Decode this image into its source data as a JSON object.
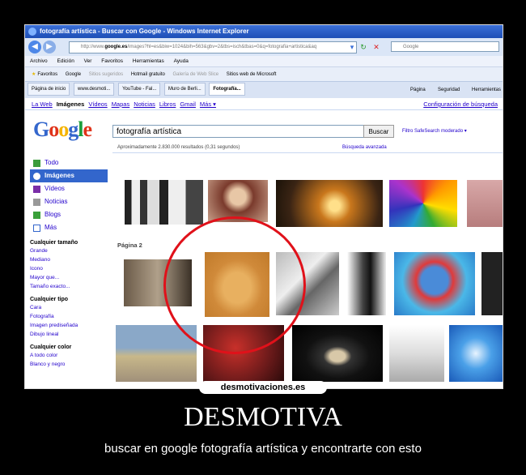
{
  "window": {
    "title": "fotografía artística - Buscar con Google - Windows Internet Explorer"
  },
  "address": {
    "prefix": "http://www.",
    "domain": "google.es",
    "rest": "/images?hl=es&biw=1024&bih=563&gbv=2&tbs=isch&tbas=0&q=fotografia+artistica&aq"
  },
  "search_placeholder": "Google",
  "menu": [
    "Archivo",
    "Edición",
    "Ver",
    "Favoritos",
    "Herramientas",
    "Ayuda"
  ],
  "favorites": {
    "label": "Favoritos",
    "items": [
      "Google",
      "Sitios sugeridos",
      "Hotmail gratuito",
      "Galería de Web Slice",
      "Sitios web de Microsoft"
    ]
  },
  "tabs": [
    "Página de inicio",
    "www.desmoti...",
    "YouTube - Fal...",
    "Muro de Berli...",
    "Fotografía..."
  ],
  "commands": [
    "Página",
    "Seguridad",
    "Herramientas"
  ],
  "google_nav": {
    "items": [
      "La Web",
      "Imágenes",
      "Vídeos",
      "Mapas",
      "Noticias",
      "Libros",
      "Gmail",
      "Más ▾"
    ],
    "active": "Imágenes",
    "right": "Configuración de búsqueda"
  },
  "logo": {
    "letters": [
      "G",
      "o",
      "o",
      "g",
      "l",
      "e"
    ],
    "colors": [
      "#3366cc",
      "#e0331a",
      "#f5b400",
      "#3366cc",
      "#1a9e3c",
      "#e0331a"
    ]
  },
  "query": "fotografía artística",
  "search_button": "Buscar",
  "safesearch": "Filtro SafeSearch moderado ▾",
  "results_text": "Aproximadamente 2.830.000 resultados (0,31 segundos)",
  "advanced": "Búsqueda avanzada",
  "sidebar": {
    "items": [
      {
        "label": "Todo",
        "icon": "all-icon",
        "color": "#3b9c3b"
      },
      {
        "label": "Imágenes",
        "icon": "images-icon",
        "color": "#ffffff",
        "active": true
      },
      {
        "label": "Vídeos",
        "icon": "videos-icon",
        "color": "#7a2ea8"
      },
      {
        "label": "Noticias",
        "icon": "news-icon",
        "color": "#999999"
      },
      {
        "label": "Blogs",
        "icon": "blogs-icon",
        "color": "#3aa03a"
      },
      {
        "label": "Más",
        "icon": "more-icon",
        "color": "#3366cc"
      }
    ],
    "size_title": "Cualquier tamaño",
    "size_options": [
      "Grande",
      "Mediano",
      "Icono",
      "Mayor que...",
      "Tamaño exacto..."
    ],
    "type_title": "Cualquier tipo",
    "type_options": [
      "Cara",
      "Fotografía",
      "Imagen prediseñada",
      "Dibujo lineal"
    ],
    "color_title": "Cualquier color",
    "color_options": [
      "A todo color",
      "Blanco y negro"
    ]
  },
  "pagina": "Página 2",
  "watermark": "desmotivaciones.es",
  "caption": {
    "title": "DESMOTIVA",
    "subtitle": "buscar en google fotografía artística y encontrarte con esto"
  }
}
